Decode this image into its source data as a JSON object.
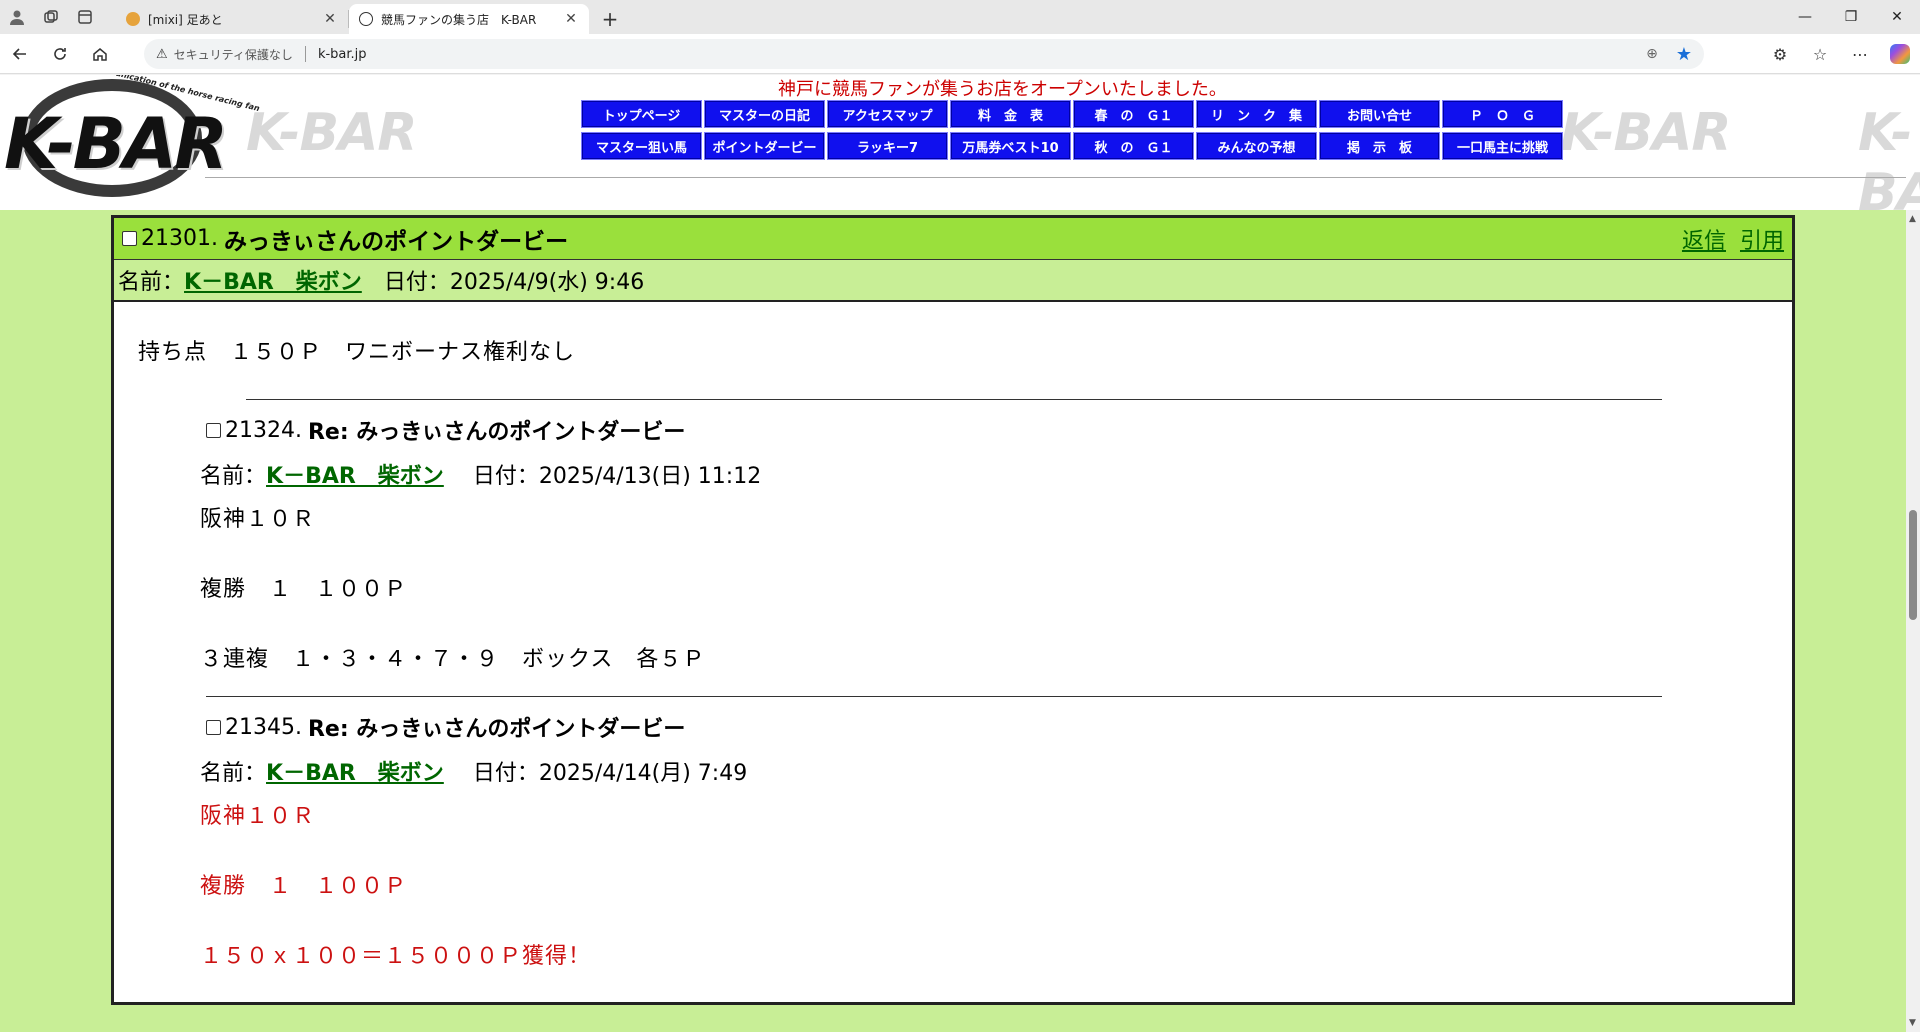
{
  "browser": {
    "tabs": [
      {
        "title": "[mixi] 足あと",
        "active": false,
        "close": "✕"
      },
      {
        "title": "競馬ファンの集う店　K-BAR",
        "active": true,
        "close": "✕"
      }
    ],
    "new_tab": "+",
    "address": {
      "security_label": "セキュリティ保護なし",
      "url": "k-bar.jp"
    },
    "window_controls": {
      "minimize": "—",
      "restore": "❐",
      "close": "✕"
    }
  },
  "site": {
    "logo": {
      "text": "K-BAR",
      "tagline": "Communication of the horse racing fan"
    },
    "watermark": "K-BAR",
    "announcement": "神戸に競馬ファンが集うお店をオープンいたしました。",
    "nav": [
      "トップページ",
      "マスターの日記",
      "アクセスマップ",
      "料　金　表",
      "春　の　Ｇ１",
      "リ　ン　ク　集",
      "お問い合せ",
      "Ｐ　Ｏ　Ｇ",
      "マスター狙い馬",
      "ポイントダービー",
      "ラッキー7",
      "万馬券ベスト10",
      "秋　の　Ｇ１",
      "みんなの予想",
      "掲　示　板",
      "一口馬主に挑戦"
    ]
  },
  "post": {
    "number": "21301.",
    "title": "みっきぃさんのポイントダービー",
    "reply_link": "返信",
    "quote_link": "引用",
    "name_label": "名前：",
    "author": "K－BAR　柴ボン",
    "date_label": "日付：",
    "date": "2025/4/9(水) 9:46",
    "body": "持ち点　１５０Ｐ　ワニボーナス権利なし",
    "replies": [
      {
        "number": "21324.",
        "title": "Re: みっきぃさんのポイントダービー",
        "name_label": "名前：",
        "author": "K－BAR　柴ボン",
        "date_label": "日付：",
        "date": "2025/4/13(日) 11:12",
        "lines": [
          "阪神１０Ｒ",
          "複勝　１　１００Ｐ",
          "３連複　１・３・４・７・９　ボックス　各５Ｐ"
        ]
      },
      {
        "number": "21345.",
        "title": "Re: みっきぃさんのポイントダービー",
        "name_label": "名前：",
        "author": "K－BAR　柴ボン",
        "date_label": "日付：",
        "date": "2025/4/14(月) 7:49",
        "lines": [
          "阪神１０Ｒ",
          "複勝　１　１００Ｐ",
          "１５０ｘ１００＝１５０００Ｐ獲得！"
        ]
      }
    ]
  },
  "colors": {
    "nav_bg": "#1010ee",
    "header_green": "#9ae03c",
    "meta_green": "#c8ee96",
    "link_green": "#006600",
    "highlight_red": "#cc1111",
    "announce_red": "#cc0000"
  }
}
